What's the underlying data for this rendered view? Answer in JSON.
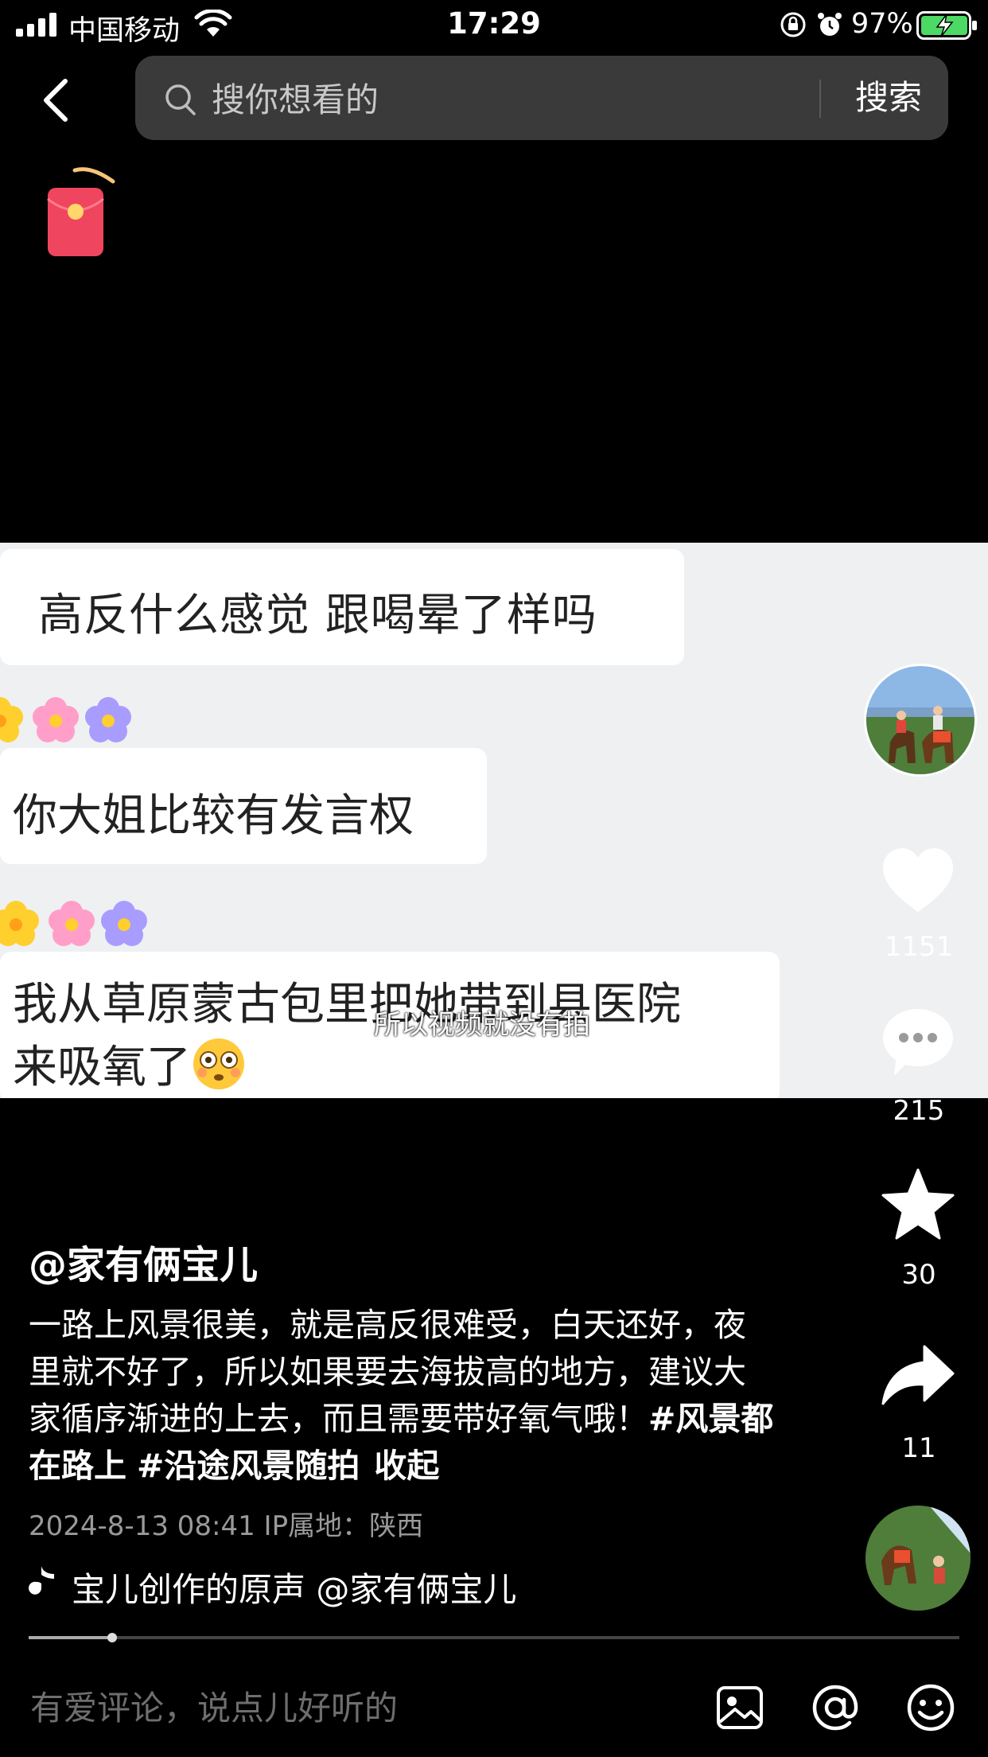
{
  "status_bar": {
    "carrier": "中国移动",
    "time": "17:29",
    "battery": "97%"
  },
  "search": {
    "placeholder": "搜你想看的",
    "button_label": "搜索"
  },
  "video": {
    "chat_messages": [
      "高反什么感觉  跟喝晕了样吗",
      "你大姐比较有发言权",
      "我从草原蒙古包里把她带到县医院\n来吸氧了"
    ],
    "subtitle": "所以视频就没有拍"
  },
  "actions": {
    "likes": "1151",
    "comments": "215",
    "favorites": "30",
    "shares": "11"
  },
  "caption": {
    "handle": "@家有俩宝儿",
    "text": "一路上风景很美，就是高反很难受，白天还好，夜里就不好了，所以如果要去海拔高的地方，建议大家循序渐进的上去，而且需要带好氧气哦！",
    "hashtags": [
      "#风景都在路上",
      "#沿途风景随拍"
    ],
    "fold_label": "收起",
    "meta": "2024-8-13 08:41   IP属地：陕西",
    "music": "宝儿创作的原声    @家有俩宝儿"
  },
  "progress": 0.09,
  "comment_box": {
    "placeholder": "有爱评论，说点儿好听的"
  },
  "icons": [
    "signal-icon",
    "wifi-icon",
    "lock-rotation-icon",
    "alarm-icon",
    "battery-icon",
    "back-icon",
    "search-icon",
    "red-packet-icon",
    "heart-icon",
    "comment-icon",
    "star-icon",
    "share-icon",
    "music-note-icon",
    "image-icon",
    "at-icon",
    "emoji-icon"
  ],
  "colors": {
    "background": "#000000",
    "search_bg": "#3a3a3a",
    "battery_green": "#4cd964"
  }
}
